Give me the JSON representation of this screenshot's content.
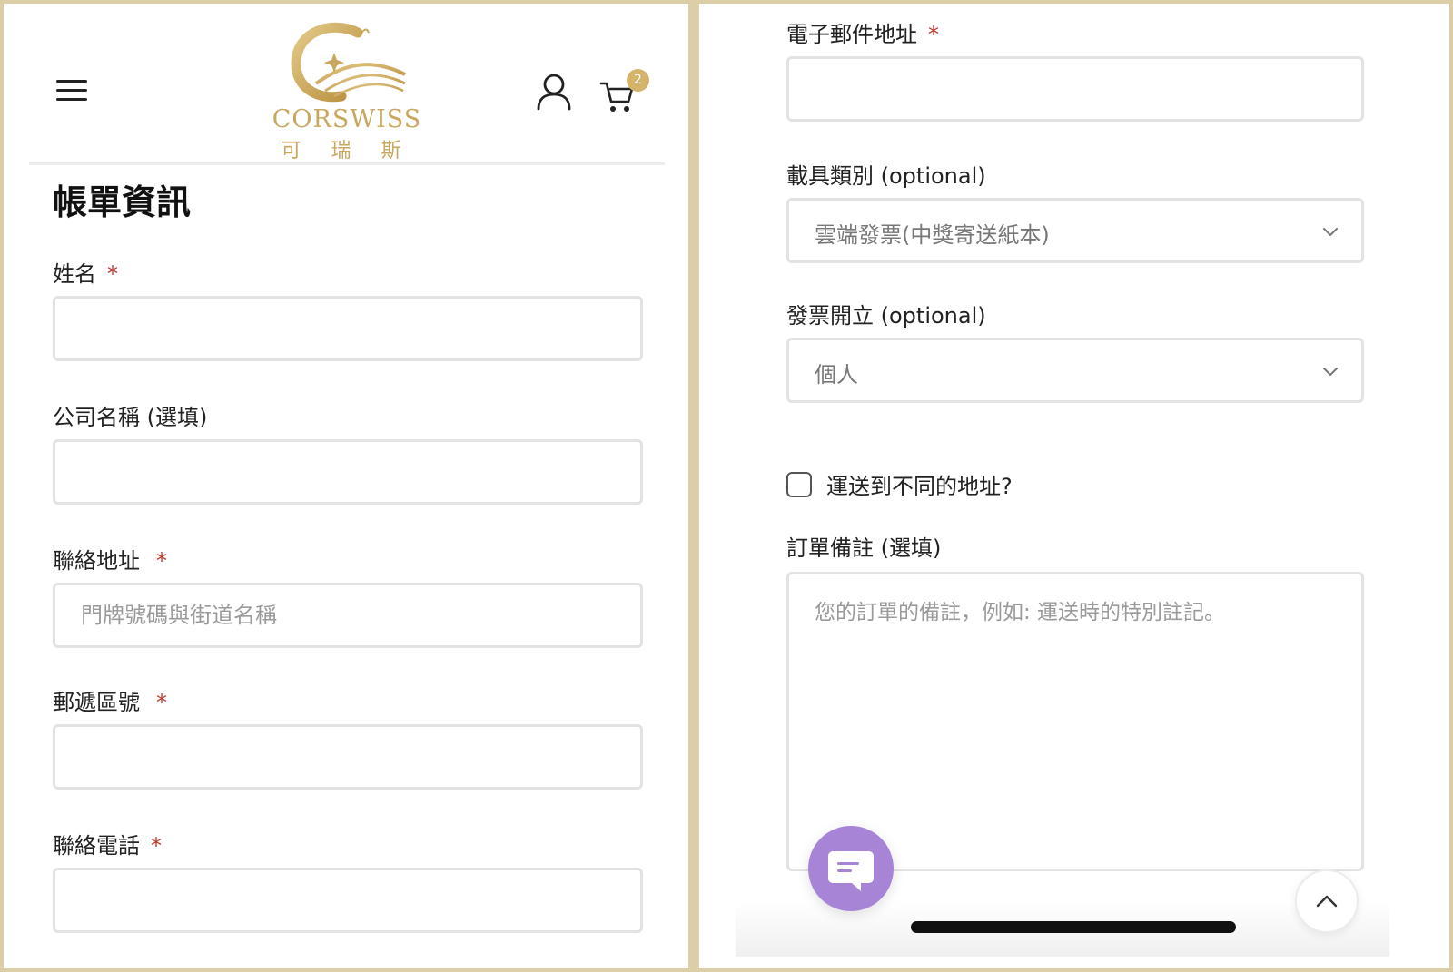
{
  "header": {
    "logo_text_en": "CORSWISS",
    "logo_text_zh": "可 瑞 斯",
    "cart_count": "2"
  },
  "billing": {
    "title": "帳單資訊",
    "required_mark": "*",
    "fields": {
      "name": {
        "label": "姓名",
        "value": ""
      },
      "company": {
        "label": "公司名稱 (選填)",
        "value": ""
      },
      "address": {
        "label": "聯絡地址",
        "value": "",
        "placeholder": "門牌號碼與街道名稱"
      },
      "postcode": {
        "label": "郵遞區號",
        "value": ""
      },
      "phone": {
        "label": "聯絡電話",
        "value": ""
      },
      "email": {
        "label": "電子郵件地址",
        "value": ""
      }
    },
    "carrier_type": {
      "label": "載具類別 (optional)",
      "selected": "雲端發票(中獎寄送紙本)"
    },
    "invoice_type": {
      "label": "發票開立 (optional)",
      "selected": "個人"
    },
    "ship_different": {
      "label": "運送到不同的地址?",
      "checked": false
    },
    "order_notes": {
      "label": "訂單備註 (選填)",
      "placeholder": "您的訂單的備註，例如: 運送時的特別註記。"
    }
  },
  "colors": {
    "frame": "#dccfa8",
    "brand_gold": "#c8a85e",
    "required": "#c0392b",
    "chat_purple": "#a784d6"
  },
  "icons": {
    "menu": "hamburger-icon",
    "account": "user-icon",
    "cart": "cart-icon",
    "dropdown": "chevron-down-icon",
    "chat": "chat-bubble-icon",
    "scroll_top": "chevron-up-icon"
  }
}
